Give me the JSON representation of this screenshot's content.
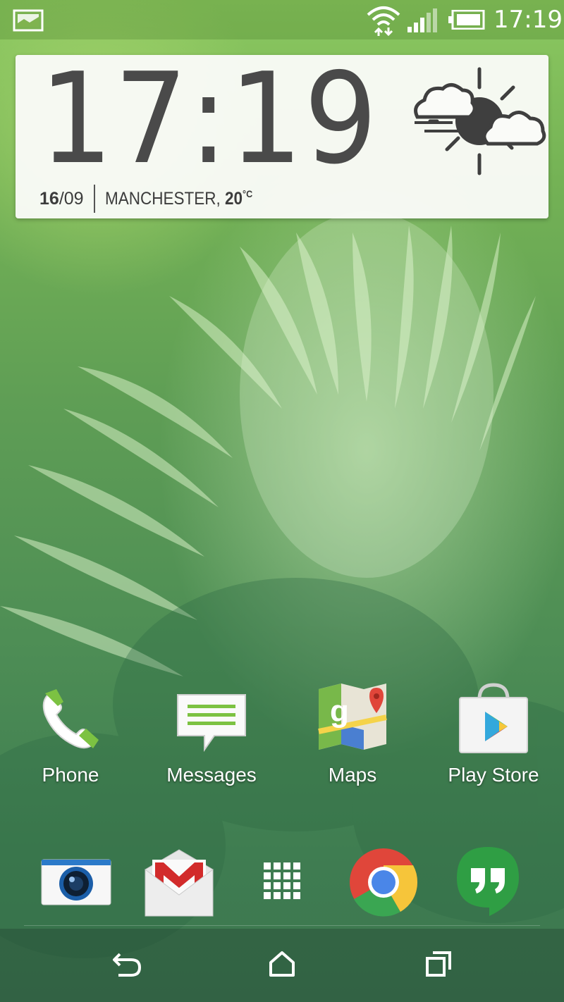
{
  "status_bar": {
    "time": "17:19",
    "icons": [
      "notification-image-icon",
      "wifi-icon",
      "signal-icon",
      "battery-icon"
    ]
  },
  "clock_widget": {
    "time": "17:19",
    "day": "16",
    "month": "/09",
    "city": "MANCHESTER, ",
    "temperature": "20",
    "unit": "°C",
    "weather_icon": "partly-sunny-icon"
  },
  "apps": [
    {
      "label": "Phone",
      "icon": "phone-icon"
    },
    {
      "label": "Messages",
      "icon": "messages-icon"
    },
    {
      "label": "Maps",
      "icon": "maps-icon"
    },
    {
      "label": "Play Store",
      "icon": "play-store-icon"
    }
  ],
  "dock": [
    {
      "icon": "camera-icon"
    },
    {
      "icon": "gmail-icon"
    },
    {
      "icon": "app-drawer-icon"
    },
    {
      "icon": "chrome-icon"
    },
    {
      "icon": "hangouts-icon"
    }
  ],
  "nav_bar": {
    "buttons": [
      "back-icon",
      "home-icon",
      "recents-icon"
    ]
  },
  "colors": {
    "accent_green": "#7cc242",
    "widget_text": "#4a4a4a"
  }
}
